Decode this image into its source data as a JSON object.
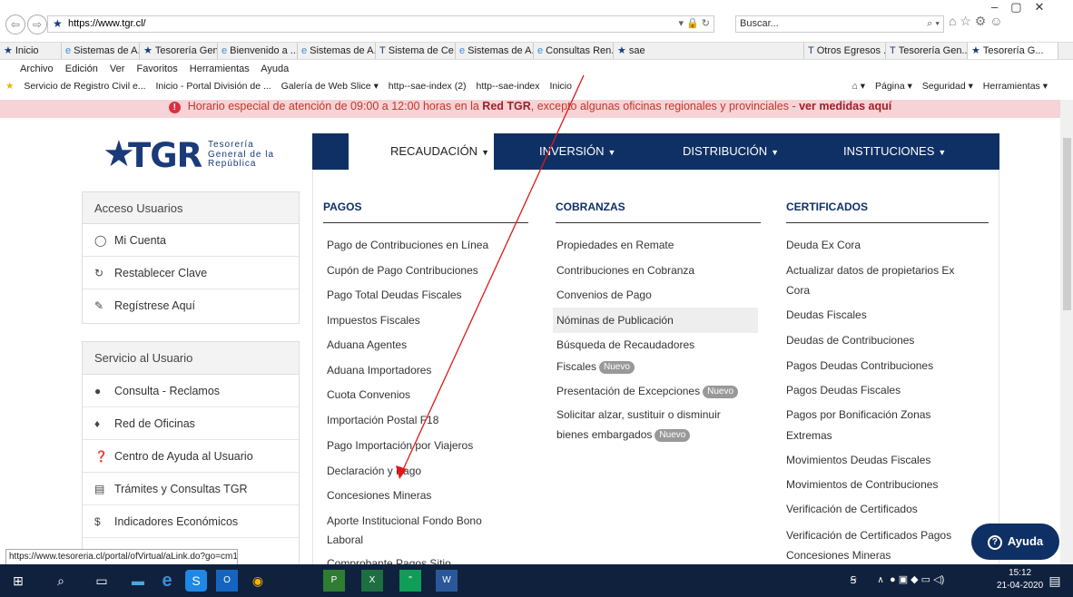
{
  "browser": {
    "url": "https://www.tgr.cl/",
    "search_placeholder": "Buscar...",
    "tabs": [
      "Inicio",
      "Sistemas de A...",
      "Tesorería Gen...",
      "Bienvenido a ...",
      "Sistemas de A...",
      "Sistema de Ce...",
      "Sistemas de A...",
      "Consultas Ren...",
      "sae",
      "Otros Egresos ...",
      "Tesorería Gen...",
      "Tesorería G..."
    ],
    "menu": [
      "Archivo",
      "Edición",
      "Ver",
      "Favoritos",
      "Herramientas",
      "Ayuda"
    ],
    "favorites": [
      "Servicio de Registro Civil e...",
      "Inicio - Portal División de ...",
      "Galería de Web Slice ▾",
      "http--sae-index (2)",
      "http--sae-index",
      "Inicio"
    ],
    "tools": [
      "Página ▾",
      "Seguridad ▾",
      "Herramientas ▾"
    ],
    "status_url": "https://www.tesoreria.cl/portal/ofVirtual/aLink.do?go=cm14&wptgr=s"
  },
  "alert": {
    "text_pre": "Horario especial de atención de 09:00 a 12:00 horas en la ",
    "bold1": "Red TGR",
    "text_mid": ", excepto algunas oficinas regionales y provinciales - ",
    "bold2": "ver medidas aquí"
  },
  "logo": {
    "main": "TGR",
    "line1": "Tesorería",
    "line2": "General de la",
    "line3": "República"
  },
  "nav": [
    "RECAUDACIÓN",
    "INVERSIÓN",
    "DISTRIBUCIÓN",
    "INSTITUCIONES"
  ],
  "sidebar": {
    "access": {
      "title": "Acceso Usuarios",
      "items": [
        "Mi Cuenta",
        "Restablecer Clave",
        "Regístrese Aquí"
      ]
    },
    "service": {
      "title": "Servicio al Usuario",
      "items": [
        "Consulta - Reclamos",
        "Red de Oficinas",
        "Centro de Ayuda al Usuario",
        "Trámites y Consultas TGR",
        "Indicadores Económicos"
      ]
    }
  },
  "mega": {
    "pagos": {
      "title": "PAGOS",
      "items": [
        "Pago de Contribuciones en Línea",
        "Cupón de Pago Contribuciones",
        "Pago Total Deudas Fiscales",
        "Impuestos Fiscales",
        "Aduana Agentes",
        "Aduana Importadores",
        "Cuota Convenios",
        "Importación Postal F18",
        "Pago Importación por Viajeros",
        "Declaración y Pago",
        "Concesiones Mineras",
        "Aporte Institucional Fondo Bono",
        "Laboral",
        "Comprobante Pagos Sitio"
      ]
    },
    "cobranzas": {
      "title": "COBRANZAS",
      "items": [
        "Propiedades en Remate",
        "Contribuciones en Cobranza",
        "Convenios de Pago",
        "Nóminas de Publicación",
        "Búsqueda de Recaudadores",
        "Fiscales",
        "Presentación de Excepciones",
        "Solicitar alzar, sustituir o disminuir",
        "bienes embargados"
      ],
      "badge": "Nuevo"
    },
    "certificados": {
      "title": "CERTIFICADOS",
      "items": [
        "Deuda Ex Cora",
        "Actualizar datos de propietarios Ex",
        "Cora",
        "Deudas Fiscales",
        "Deudas de Contribuciones",
        "Pagos Deudas Contribuciones",
        "Pagos Deudas Fiscales",
        "Pagos por Bonificación Zonas",
        "Extremas",
        "Movimientos Deudas Fiscales",
        "Movimientos de Contribuciones",
        "Verificación de Certificados",
        "Verificación de Certificados Pagos",
        "Concesiones Mineras"
      ]
    }
  },
  "ayuda": "Ayuda",
  "taskbar": {
    "time": "15:12",
    "date": "21-04-2020"
  },
  "colors": {
    "navy": "#0f3064",
    "alert_bg": "#f6d3d6",
    "alert_text": "#c0392b"
  }
}
